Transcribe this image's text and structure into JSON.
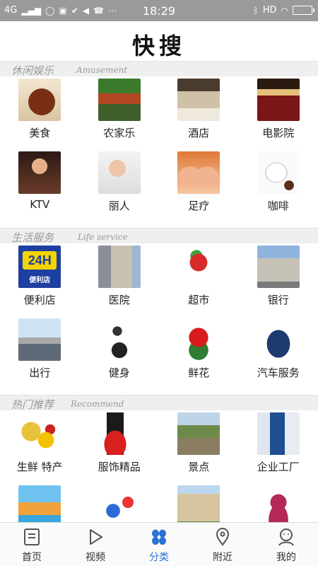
{
  "status_bar": {
    "network": "4G",
    "time": "18:29",
    "hd": "HD",
    "left_icons": [
      "signal-icon",
      "message-bubble-icon",
      "sim-icon",
      "check-circle-icon",
      "volume-icon",
      "phone-icon",
      "more-icon"
    ],
    "right_icons": [
      "bluetooth-icon",
      "wifi-icon",
      "battery-icon"
    ]
  },
  "header": {
    "title": "快搜"
  },
  "sections": [
    {
      "title_cn": "休闲娱乐",
      "title_en": "Amusement",
      "items": [
        {
          "label": "美食",
          "icon": "food-photo"
        },
        {
          "label": "农家乐",
          "icon": "farm-stay-photo"
        },
        {
          "label": "酒店",
          "icon": "hotel-photo"
        },
        {
          "label": "电影院",
          "icon": "cinema-photo"
        },
        {
          "label": "KTV",
          "icon": "ktv-photo"
        },
        {
          "label": "丽人",
          "icon": "beauty-photo"
        },
        {
          "label": "足疗",
          "icon": "foot-massage-photo"
        },
        {
          "label": "咖啡",
          "icon": "coffee-photo"
        }
      ]
    },
    {
      "title_cn": "生活服务",
      "title_en": "Life service",
      "items": [
        {
          "label": "便利店",
          "icon": "convenience-store-photo",
          "thumb_text": "24H",
          "thumb_subtext": "便利店"
        },
        {
          "label": "医院",
          "icon": "hospital-photo"
        },
        {
          "label": "超市",
          "icon": "supermarket-photo"
        },
        {
          "label": "银行",
          "icon": "bank-photo"
        },
        {
          "label": "出行",
          "icon": "travel-photo"
        },
        {
          "label": "健身",
          "icon": "fitness-photo"
        },
        {
          "label": "鲜花",
          "icon": "flowers-photo"
        },
        {
          "label": "汽车服务",
          "icon": "car-service-photo"
        }
      ]
    },
    {
      "title_cn": "热门推荐",
      "title_en": "Recommend",
      "items": [
        {
          "label": "生鲜 特产",
          "icon": "fresh-produce-photo"
        },
        {
          "label": "服饰精品",
          "icon": "fashion-photo"
        },
        {
          "label": "景点",
          "icon": "scenic-spot-photo"
        },
        {
          "label": "企业工厂",
          "icon": "company-factory-photo"
        },
        {
          "label": "",
          "icon": "water-park-photo"
        },
        {
          "label": "",
          "icon": "training-photo"
        },
        {
          "label": "",
          "icon": "real-estate-photo"
        },
        {
          "label": "",
          "icon": "health-care-photo"
        }
      ]
    }
  ],
  "bottom_nav": [
    {
      "label": "首页",
      "icon": "home-icon",
      "active": false
    },
    {
      "label": "视频",
      "icon": "play-icon",
      "active": false
    },
    {
      "label": "分类",
      "icon": "category-icon",
      "active": true
    },
    {
      "label": "附近",
      "icon": "location-pin-icon",
      "active": false
    },
    {
      "label": "我的",
      "icon": "profile-icon",
      "active": false
    }
  ],
  "colors": {
    "accent": "#2b72d6",
    "status_bar": "#9a9a9a",
    "section_bar": "#efefef",
    "section_text": "#9a9a9a"
  }
}
